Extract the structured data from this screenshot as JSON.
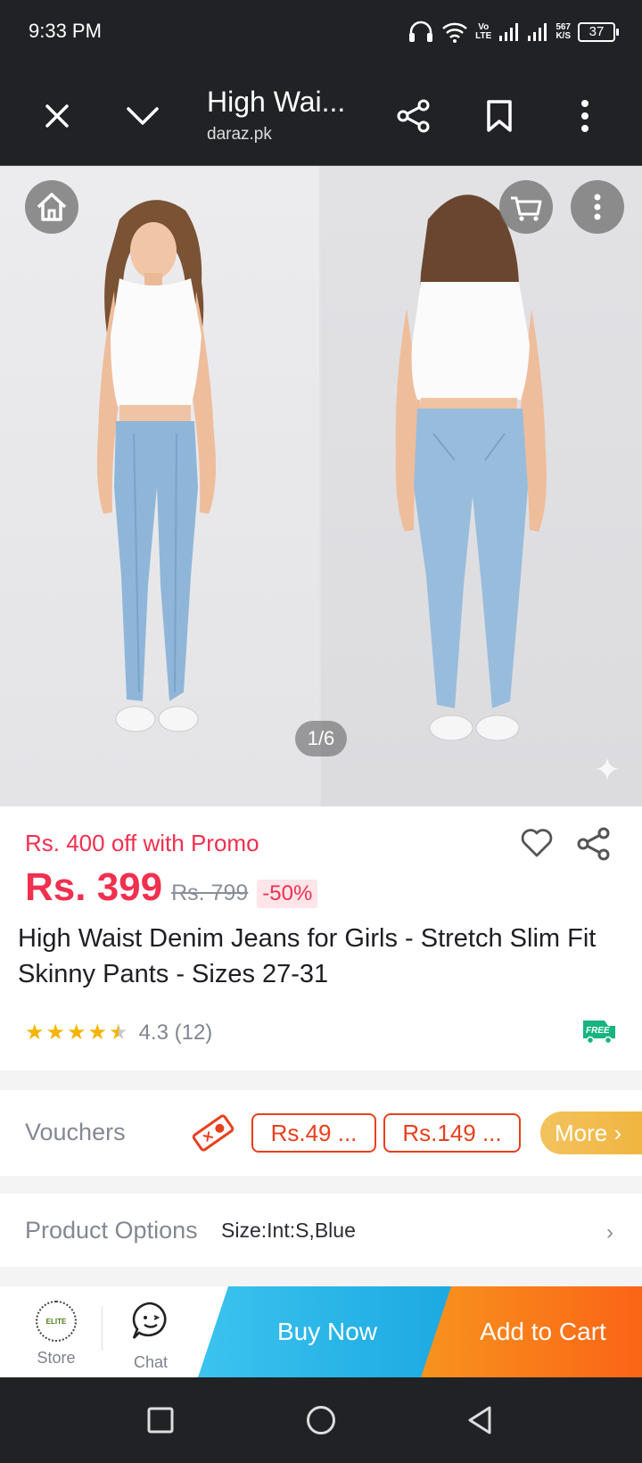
{
  "status_bar": {
    "time": "9:33 PM",
    "volte_top": "Vo",
    "volte_bottom": "LTE",
    "speed_value": "567",
    "speed_unit": "K/S",
    "battery": "37"
  },
  "tab_bar": {
    "title": "High Wai...",
    "url": "daraz.pk",
    "icons": [
      "close-icon",
      "chevron-down-icon",
      "share-icon",
      "bookmark-icon",
      "more-vertical-icon"
    ]
  },
  "gallery": {
    "counter": "1/6",
    "icons": [
      "home-icon",
      "cart-icon",
      "more-vertical-icon"
    ]
  },
  "product": {
    "promo": "Rs. 400 off with Promo",
    "price": "Rs. 399",
    "original_price": "Rs. 799",
    "discount": "-50%",
    "title": "High Waist Denim Jeans for Girls - Stretch Slim Fit Skinny Pants - Sizes 27-31",
    "rating_value": 4.3,
    "rating_text": "4.3 (12)",
    "free_badge": "FREE"
  },
  "vouchers": {
    "label": "Vouchers",
    "items": [
      "Rs.49 ...",
      "Rs.149 ..."
    ],
    "more": "More"
  },
  "options": {
    "label": "Product Options",
    "value": "Size:Int:S,Blue"
  },
  "action_bar": {
    "store_label": "Store",
    "store_logo_text": "ELITE",
    "chat_label": "Chat",
    "buy_now": "Buy Now",
    "add_to_cart": "Add to Cart"
  },
  "colors": {
    "price_red": "#f0304f",
    "buy_blue": "#1ba9e1",
    "cart_orange": "#fb6416",
    "voucher_red": "#e8401e",
    "more_gold": "#f1b43e",
    "dark_bar": "#212226"
  }
}
